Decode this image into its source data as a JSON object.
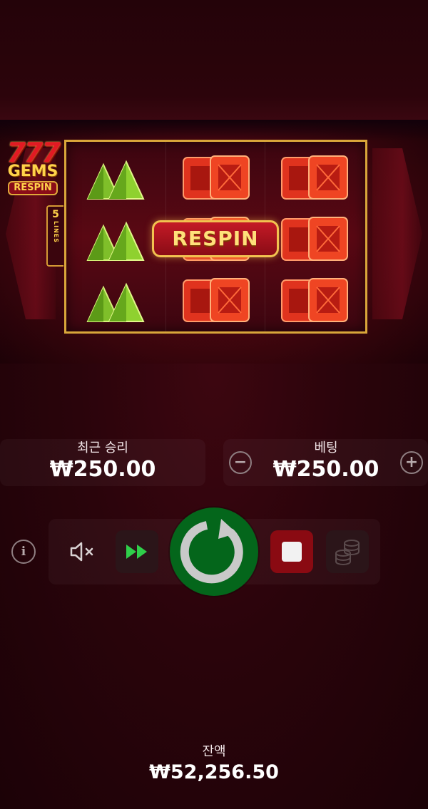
{
  "game": {
    "logo": {
      "number": "777",
      "name": "GEMS",
      "tag": "RESPIN"
    },
    "lines": {
      "count": "5",
      "word": "LINES"
    },
    "respin_banner": "RESPIN",
    "reels": [
      [
        "green-gem",
        "green-gem",
        "green-gem"
      ],
      [
        "red-gem",
        "red-gem",
        "red-gem"
      ],
      [
        "red-gem",
        "red-gem",
        "red-gem"
      ]
    ]
  },
  "stats": {
    "last_win_label": "최근 승리",
    "last_win_value": "₩250.00",
    "bet_label": "베팅",
    "bet_value": "₩250.00"
  },
  "controls": {
    "info_icon": "info-icon",
    "mute_icon": "speaker-muted-icon",
    "turbo_icon": "fast-forward-icon",
    "spin_icon": "spin-arrow-icon",
    "stop_icon": "stop-icon",
    "coins_icon": "coins-stack-icon",
    "minus_symbol": "−",
    "plus_symbol": "+",
    "info_symbol": "i"
  },
  "balance": {
    "label": "잔액",
    "value": "₩52,256.50"
  },
  "colors": {
    "spin_button": "#04661b",
    "stop_button": "#8a0a12",
    "turbo_arrows": "#2fcf4a",
    "reel_frame": "#d9a63a",
    "background": "#2a040b"
  }
}
